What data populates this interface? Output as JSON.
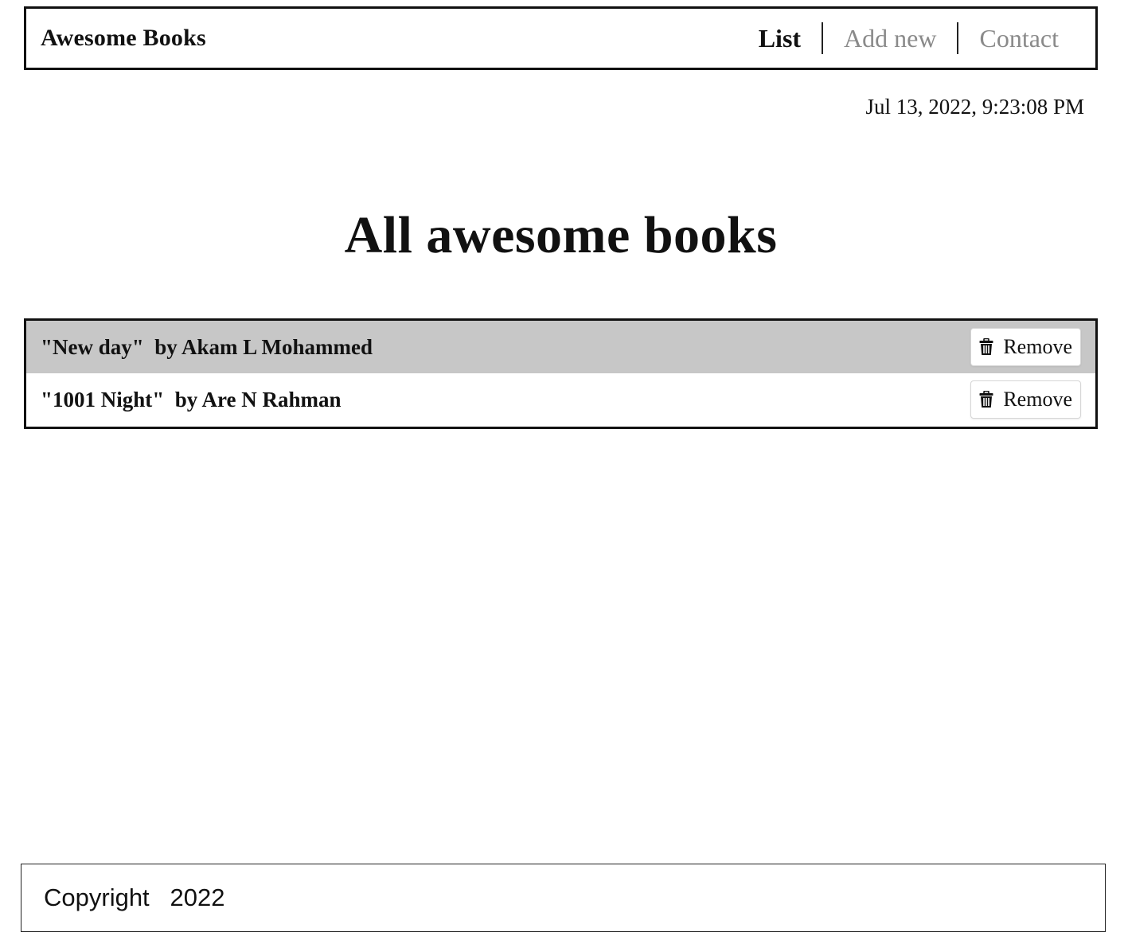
{
  "header": {
    "brand": "Awesome Books",
    "nav": [
      {
        "label": "List",
        "active": true
      },
      {
        "label": "Add new",
        "active": false
      },
      {
        "label": "Contact",
        "active": false
      }
    ]
  },
  "datetime": "Jul 13, 2022, 9:23:08 PM",
  "main": {
    "title": "All awesome books",
    "books": [
      {
        "text": "\"New day\"  by Akam L Mohammed",
        "remove_label": "Remove",
        "remove_icon": "trash-icon"
      },
      {
        "text": "\"1001 Night\"  by Are N Rahman",
        "remove_label": "Remove",
        "remove_icon": "trash-icon"
      }
    ]
  },
  "footer": {
    "text": "Copyright   2022"
  },
  "colors": {
    "active_nav": "#111111",
    "inactive_nav": "#8a8a8a",
    "shaded_row": "#c7c7c7"
  }
}
